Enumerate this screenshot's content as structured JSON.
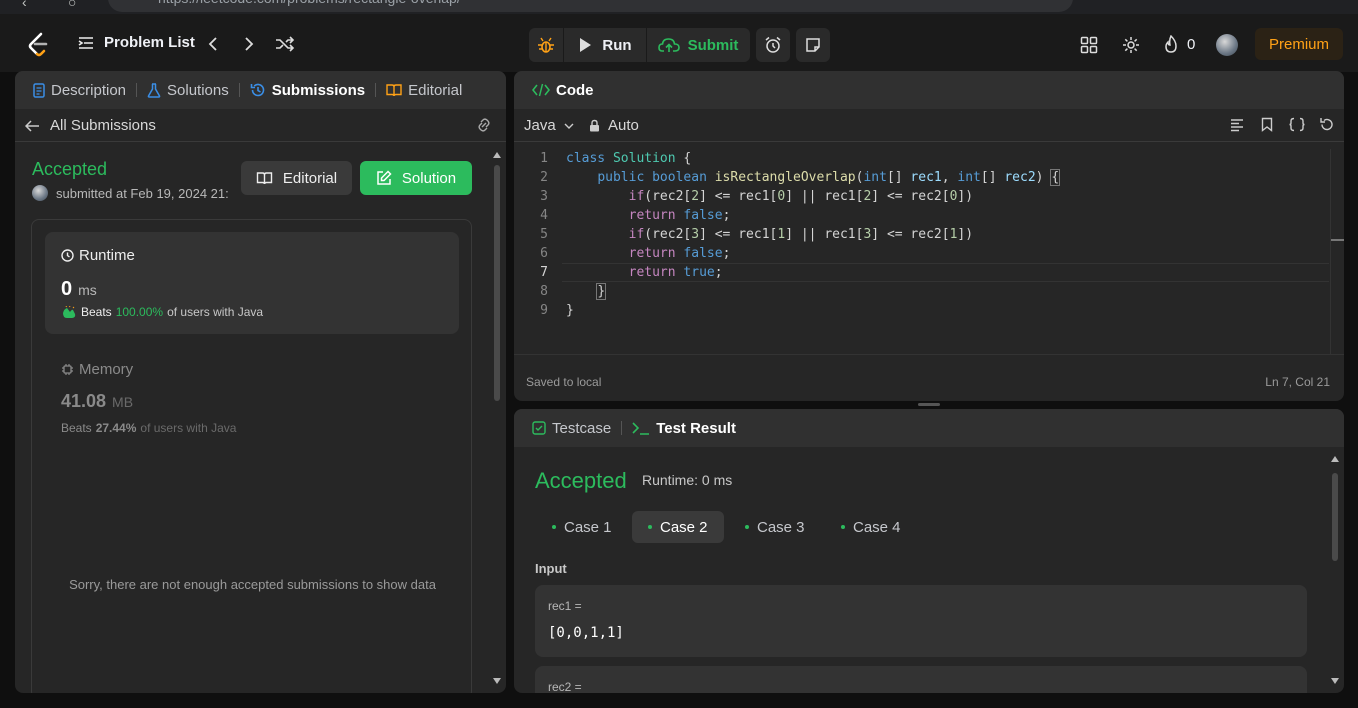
{
  "browser": {
    "url": "https://leetcode.com/problems/rectangle-overlap/"
  },
  "nav": {
    "problem_list": "Problem List",
    "run": "Run",
    "submit": "Submit",
    "streak": "0",
    "premium": "Premium"
  },
  "left": {
    "tabs": [
      "Description",
      "Solutions",
      "Submissions",
      "Editorial"
    ],
    "all_submissions": "All Submissions",
    "status": "Accepted",
    "submitted": "submitted at Feb 19, 2024 21:",
    "editorial_btn": "Editorial",
    "solution_btn": "Solution",
    "runtime": {
      "label": "Runtime",
      "value": "0",
      "unit": "ms",
      "beats_prefix": "Beats",
      "beats": "100.00%",
      "beats_suffix": "of users with Java"
    },
    "memory": {
      "label": "Memory",
      "value": "41.08",
      "unit": "MB",
      "beats_prefix": "Beats",
      "beats": "27.44%",
      "beats_suffix": "of users with Java"
    },
    "no_data": "Sorry, there are not enough accepted submissions to show data"
  },
  "code": {
    "title": "Code",
    "language": "Java",
    "mode": "Auto",
    "saved": "Saved to local",
    "cursor": "Ln 7, Col 21",
    "line_numbers": [
      "1",
      "2",
      "3",
      "4",
      "5",
      "6",
      "7",
      "8",
      "9"
    ]
  },
  "test": {
    "tab_testcase": "Testcase",
    "tab_result": "Test Result",
    "status": "Accepted",
    "runtime": "Runtime: 0 ms",
    "cases": [
      "Case 1",
      "Case 2",
      "Case 3",
      "Case 4"
    ],
    "input_label": "Input",
    "rec1_label": "rec1 =",
    "rec1_value": "[0,0,1,1]",
    "rec2_label": "rec2 ="
  },
  "colors": {
    "accepted": "#2cbb5d",
    "premium": "#ffa116",
    "accent_blue": "#3a8ee6"
  }
}
